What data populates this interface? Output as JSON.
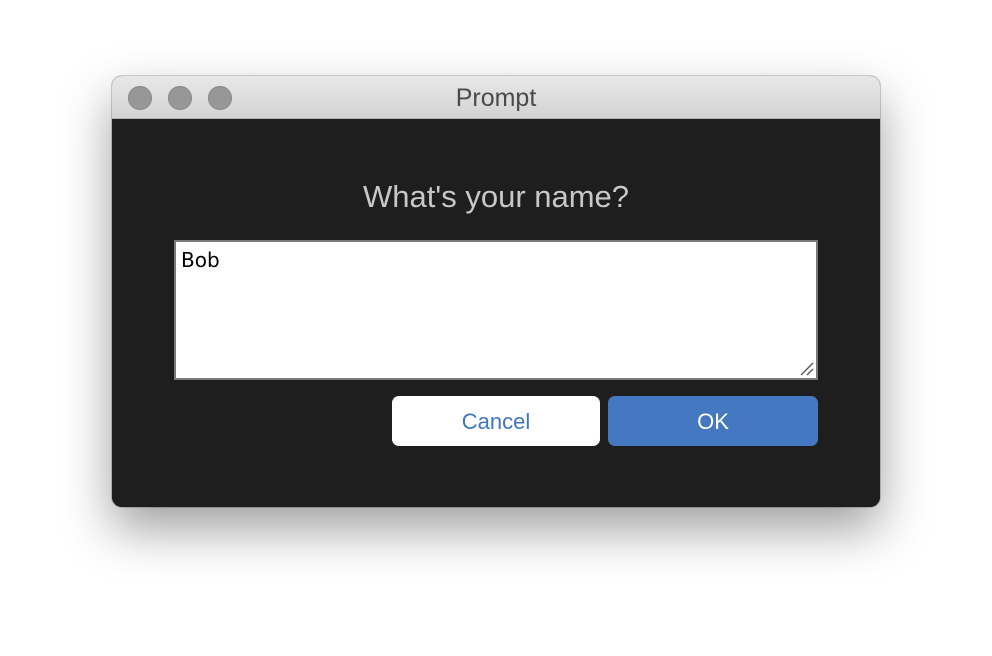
{
  "window": {
    "title": "Prompt"
  },
  "dialog": {
    "question": "What's your name?",
    "input_value": "Bob",
    "cancel_label": "Cancel",
    "ok_label": "OK"
  },
  "colors": {
    "accent": "#4478c0",
    "content_background": "#1e1e1e",
    "titlebar": "#dcdcdc"
  }
}
